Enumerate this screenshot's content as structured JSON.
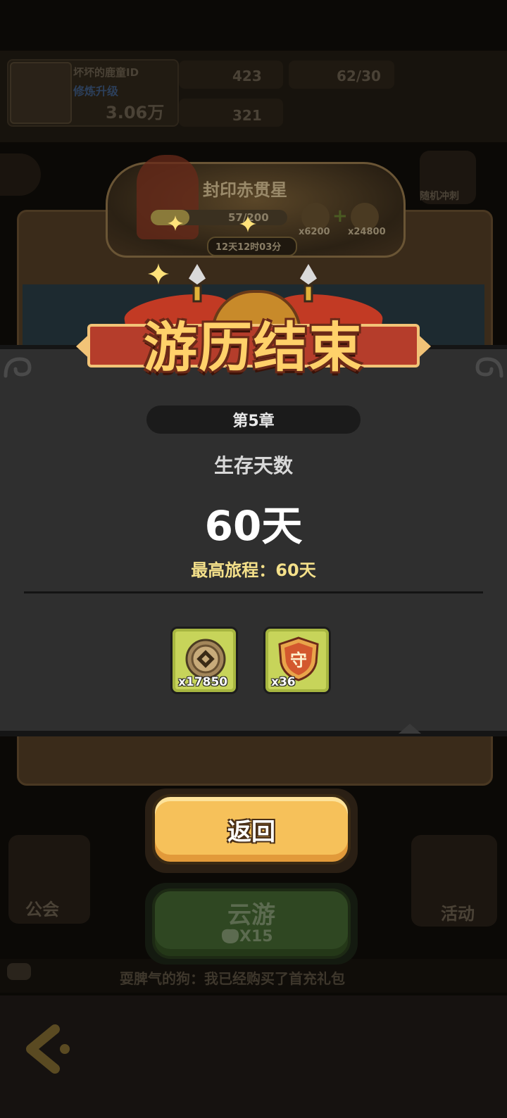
{
  "background": {
    "player": {
      "name": "坏坏的鹿童ID",
      "subtitle": "修炼升级",
      "power": "3.06万"
    },
    "resources": {
      "coins": "423",
      "stamina": "62/30",
      "gems": "321"
    },
    "banner": {
      "title": "封印赤贯星",
      "progress": "57/200",
      "reward_a": "x6200",
      "reward_b": "x24800",
      "timer": "12天12时03分"
    },
    "left_menu": "公会",
    "right_menu": "活动",
    "side_top_label": "随机冲刺",
    "chat_message": "耍脾气的狗：我已经购买了首充礼包"
  },
  "modal": {
    "title": "游历结束",
    "chapter": "第5章",
    "survival_label": "生存天数",
    "survival_days": "60天",
    "best_journey": "最高旅程：60天",
    "rewards": [
      {
        "icon": "coin-icon",
        "qty": "x17850"
      },
      {
        "icon": "guard-shield-icon",
        "qty": "x36"
      }
    ]
  },
  "buttons": {
    "return_label": "返回",
    "cloud_label": "云游",
    "cloud_cost": "X15"
  },
  "colors": {
    "title_gold": "#ffd16a",
    "best_journey_yellow": "#f4e08a",
    "reward_bg": "#c7d45a",
    "return_button": "#f6c15a",
    "ribbon_red": "#b53d2b"
  }
}
